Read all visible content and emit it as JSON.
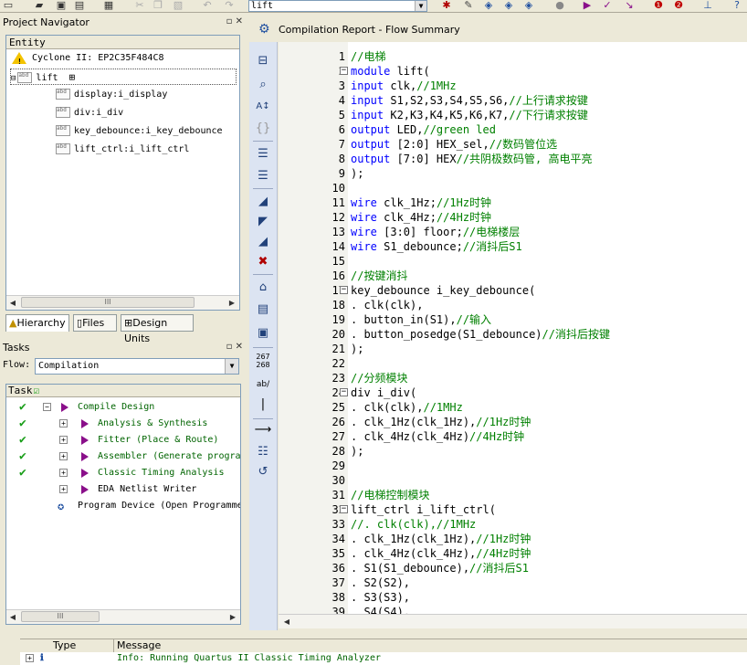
{
  "toolbar": {
    "combo_value": "lift"
  },
  "navigator": {
    "title": "Project Navigator",
    "header": "Entity",
    "device": "Cyclone II: EP2C35F484C8",
    "top_entity": "lift",
    "instances": [
      "display:i_display",
      "div:i_div",
      "key_debounce:i_key_debounce",
      "lift_ctrl:i_lift_ctrl"
    ],
    "scroll_thumb": "III",
    "tabs": [
      "Hierarchy",
      "Files",
      "Design Units"
    ]
  },
  "tasks": {
    "title": "Tasks",
    "flow_label": "Flow:",
    "flow_value": "Compilation",
    "header": "Task",
    "items": [
      {
        "label": "Compile Design",
        "done": true
      },
      {
        "label": "Analysis & Synthesis",
        "done": true
      },
      {
        "label": "Fitter (Place & Route)",
        "done": true
      },
      {
        "label": "Assembler (Generate progra",
        "done": true
      },
      {
        "label": "Classic Timing Analysis",
        "done": true
      },
      {
        "label": "EDA Netlist Writer",
        "done": false
      },
      {
        "label": "Program Device (Open Programme",
        "done": false
      }
    ],
    "scroll_thumb": "III"
  },
  "report_tab": {
    "label": "Compilation Report - Flow Summary"
  },
  "side_tools": {
    "numbers_top": "267",
    "numbers_bottom": "268",
    "ab_label": "ab/"
  },
  "editor": {
    "lines": [
      {
        "n": "1",
        "c": "//电梯"
      },
      {
        "n": "2",
        "c": "module lift("
      },
      {
        "n": "3",
        "c": "input clk,//1MHz"
      },
      {
        "n": "4",
        "c": "input S1,S2,S3,S4,S5,S6,//上行请求按键"
      },
      {
        "n": "5",
        "c": "input K2,K3,K4,K5,K6,K7,//下行请求按键"
      },
      {
        "n": "6",
        "c": "output LED,//green led"
      },
      {
        "n": "7",
        "c": "output [2:0] HEX_sel,//数码管位选"
      },
      {
        "n": "8",
        "c": "output [7:0] HEX//共阴极数码管, 高电平亮"
      },
      {
        "n": "9",
        "c": ");"
      },
      {
        "n": "10",
        "c": ""
      },
      {
        "n": "11",
        "c": "wire clk_1Hz;//1Hz时钟"
      },
      {
        "n": "12",
        "c": "wire clk_4Hz;//4Hz时钟"
      },
      {
        "n": "13",
        "c": "wire [3:0] floor;//电梯楼层"
      },
      {
        "n": "14",
        "c": "wire S1_debounce;//消抖后S1"
      },
      {
        "n": "15",
        "c": ""
      },
      {
        "n": "16",
        "c": "//按键消抖"
      },
      {
        "n": "17",
        "c": "key_debounce i_key_debounce("
      },
      {
        "n": "18",
        "c": ". clk(clk),"
      },
      {
        "n": "19",
        "c": ". button_in(S1),//输入"
      },
      {
        "n": "20",
        "c": ". button_posedge(S1_debounce)//消抖后按键"
      },
      {
        "n": "21",
        "c": ");"
      },
      {
        "n": "22",
        "c": ""
      },
      {
        "n": "23",
        "c": "//分频模块"
      },
      {
        "n": "24",
        "c": "div i_div("
      },
      {
        "n": "25",
        "c": ". clk(clk),//1MHz"
      },
      {
        "n": "26",
        "c": ". clk_1Hz(clk_1Hz),//1Hz时钟"
      },
      {
        "n": "27",
        "c": ". clk_4Hz(clk_4Hz)//4Hz时钟"
      },
      {
        "n": "28",
        "c": ");"
      },
      {
        "n": "29",
        "c": ""
      },
      {
        "n": "30",
        "c": ""
      },
      {
        "n": "31",
        "c": "//电梯控制模块"
      },
      {
        "n": "32",
        "c": "lift_ctrl i_lift_ctrl("
      },
      {
        "n": "33",
        "c": "//. clk(clk),//1MHz"
      },
      {
        "n": "34",
        "c": ". clk_1Hz(clk_1Hz),//1Hz时钟"
      },
      {
        "n": "35",
        "c": ". clk_4Hz(clk_4Hz),//4Hz时钟"
      },
      {
        "n": "36",
        "c": ". S1(S1_debounce),//消抖后S1"
      },
      {
        "n": "37",
        "c": ". S2(S2),"
      },
      {
        "n": "38",
        "c": ". S3(S3),"
      },
      {
        "n": "39",
        "c": ". S4(S4),"
      }
    ]
  },
  "messages": {
    "col_type": "Type",
    "col_message": "Message",
    "row_text": "Info: Running Quartus II Classic Timing Analyzer"
  },
  "colors": {
    "keyword": "#0000ff",
    "comment": "#008000",
    "task_text": "#006400",
    "check": "#1a9e1a"
  }
}
